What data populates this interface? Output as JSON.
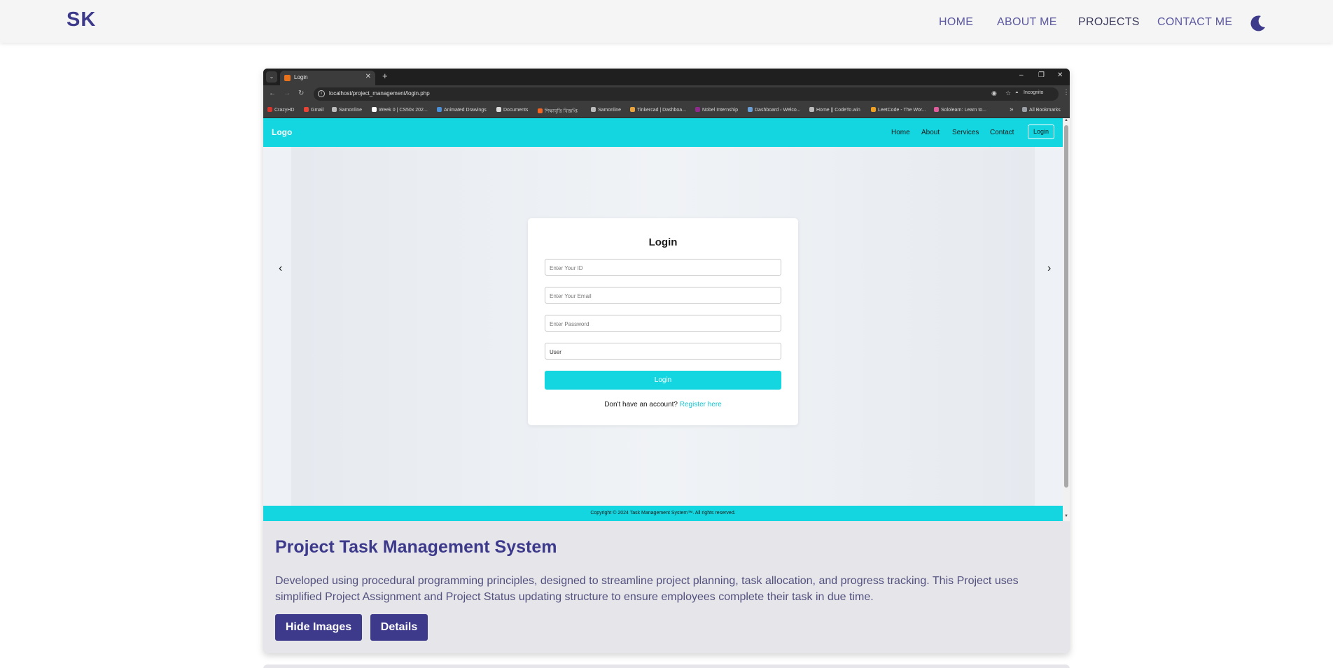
{
  "navbar": {
    "brand": "SK",
    "links": [
      "HOME",
      "ABOUT ME",
      "PROJECTS",
      "CONTACT ME"
    ],
    "active_link": "PROJECTS",
    "theme_toggle_icon": "moon-icon"
  },
  "browser": {
    "tab_title": "Login",
    "new_tab": "+",
    "window_controls": [
      "–",
      "❐",
      "✕"
    ],
    "url": "localhost/project_management/login.php",
    "incognito_label": "Incognito",
    "bookmarks": [
      "CrazyHD",
      "Gmail",
      "Samonline",
      "Week 0 | CS50x 202...",
      "Animated Drawings",
      "Documents",
      "শিক্ষাবৃত্তি বিজ্ঞপ্তি",
      "Samonline",
      "Tinkercad | Dashboa...",
      "Nobel Internship",
      "Dashboard ‹ Welco...",
      "Home || CodeTo.win",
      "LeetCode - The Wor...",
      "Sololearn: Learn to..."
    ],
    "bookmarks_more": "»",
    "all_bookmarks": "All Bookmarks"
  },
  "site": {
    "logo": "Logo",
    "nav": [
      "Home",
      "About",
      "Services",
      "Contact"
    ],
    "login_button": "Login",
    "carousel_prev": "‹",
    "carousel_next": "›",
    "form": {
      "title": "Login",
      "id_placeholder": "Enter Your ID",
      "email_placeholder": "Enter Your Email",
      "password_placeholder": "Enter Password",
      "role_value": "User",
      "submit": "Login",
      "register_prompt": "Don't have an account?",
      "register_link": "Register here"
    },
    "footer": "Copyright © 2024 Task Management System™. All rights reserved."
  },
  "project": {
    "title": "Project Task Management System",
    "description": "Developed using procedural programming principles, designed to streamline project planning, task allocation, and progress tracking. This Project uses simplified Project Assignment and Project Status updating structure to ensure employees complete their task in due time.",
    "hide_images_button": "Hide Images",
    "details_button": "Details"
  },
  "colors": {
    "primary": "#3d3a8c",
    "site_accent": "#14d6e0"
  }
}
